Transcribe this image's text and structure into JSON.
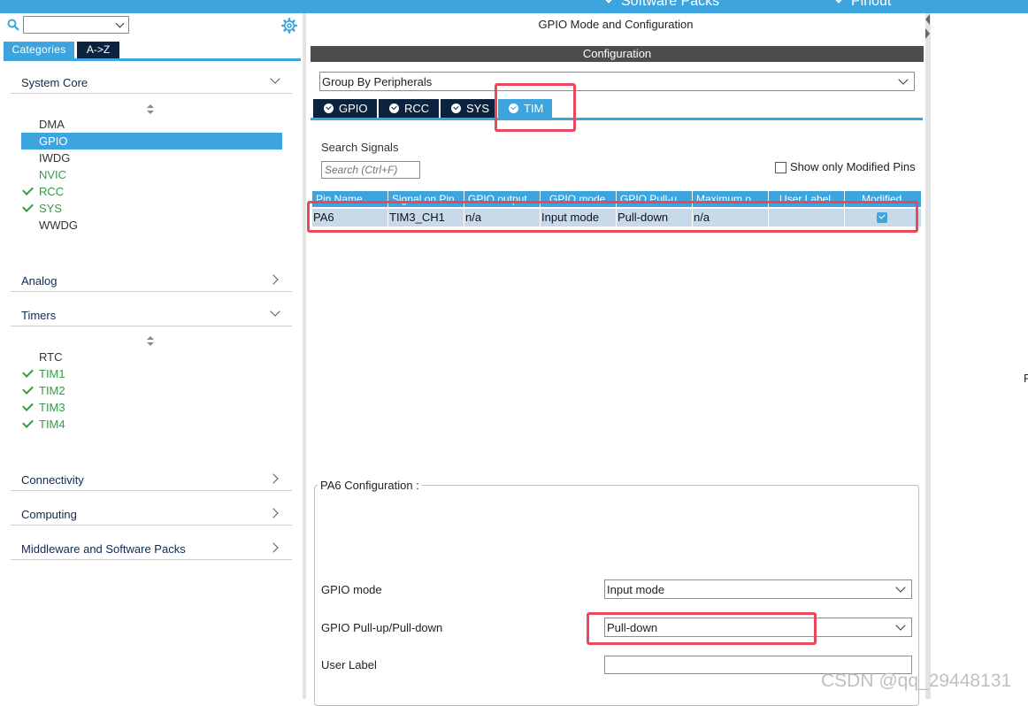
{
  "topbar": {
    "software_packs": "Software Packs",
    "pinout": "Pinout"
  },
  "sidebar": {
    "tabs": {
      "categories": "Categories",
      "az": "A->Z"
    },
    "system_core": {
      "label": "System Core",
      "items": [
        {
          "label": "DMA",
          "checked": false,
          "selected": false
        },
        {
          "label": "GPIO",
          "checked": false,
          "selected": true
        },
        {
          "label": "IWDG",
          "checked": false,
          "selected": false
        },
        {
          "label": "NVIC",
          "checked": false,
          "selected": false
        },
        {
          "label": "RCC",
          "checked": true,
          "selected": false
        },
        {
          "label": "SYS",
          "checked": true,
          "selected": false
        },
        {
          "label": "WWDG",
          "checked": false,
          "selected": false
        }
      ]
    },
    "analog": "Analog",
    "timers": {
      "label": "Timers",
      "items": [
        {
          "label": "RTC",
          "checked": false
        },
        {
          "label": "TIM1",
          "checked": true
        },
        {
          "label": "TIM2",
          "checked": true
        },
        {
          "label": "TIM3",
          "checked": true
        },
        {
          "label": "TIM4",
          "checked": true
        }
      ]
    },
    "connectivity": "Connectivity",
    "computing": "Computing",
    "middleware": "Middleware and Software Packs"
  },
  "main": {
    "title": "GPIO Mode and Configuration",
    "configuration": "Configuration",
    "group_by": "Group By Peripherals",
    "peripheral_tabs": [
      "GPIO",
      "RCC",
      "SYS",
      "TIM"
    ],
    "active_tab": "TIM",
    "search_signals_label": "Search Signals",
    "search_placeholder": "Search (Ctrl+F)",
    "show_modified_label": "Show only Modified Pins",
    "table": {
      "headers": [
        "Pin Name",
        "Signal on Pin",
        "GPIO output ...",
        "GPIO mode",
        "GPIO Pull-u...",
        "Maximum o...",
        "User Label",
        "Modified"
      ],
      "row": {
        "pin_name": "PA6",
        "signal": "TIM3_CH1",
        "gpio_output": "n/a",
        "gpio_mode": "Input mode",
        "pull": "Pull-down",
        "max_output": "n/a",
        "user_label": "",
        "modified": true
      }
    },
    "pa6_config": {
      "title": "PA6 Configuration :",
      "gpio_mode_label": "GPIO mode",
      "gpio_mode_value": "Input mode",
      "pull_label": "GPIO Pull-up/Pull-down",
      "pull_value": "Pull-down",
      "user_label_label": "User Label",
      "user_label_value": ""
    }
  },
  "right_edge_text": "F",
  "watermark": "CSDN @qq_29448131",
  "colors": {
    "accent_blue": "#3ea4dd",
    "navy": "#0c2340",
    "check_green": "#2da044",
    "highlight_red": "#e8475d",
    "config_bar": "#4d4d4d"
  }
}
